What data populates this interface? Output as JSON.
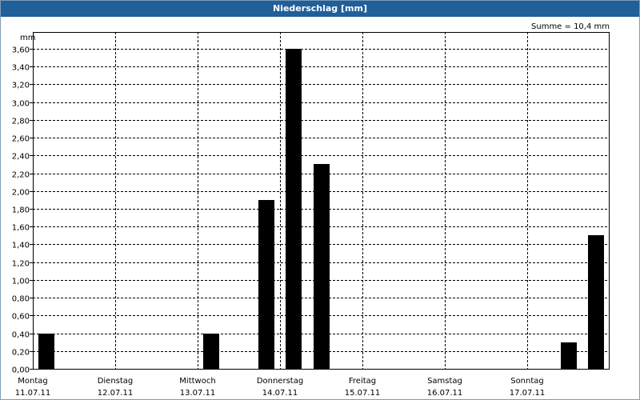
{
  "title": "Niederschlag [mm]",
  "summary": "Summe = 10,4 mm",
  "y_unit": "mm",
  "chart_data": {
    "type": "bar",
    "title": "Niederschlag [mm]",
    "ylabel": "mm",
    "xlabel": "",
    "ylim": [
      0,
      3.8
    ],
    "grid": true,
    "y_ticks": [
      "0,00",
      "0,20",
      "0,40",
      "0,60",
      "0,80",
      "1,00",
      "1,20",
      "1,40",
      "1,60",
      "1,80",
      "2,00",
      "2,20",
      "2,40",
      "2,60",
      "2,80",
      "3,00",
      "3,20",
      "3,40",
      "3,60"
    ],
    "days": [
      {
        "name": "Montag",
        "date": "11.07.11"
      },
      {
        "name": "Dienstag",
        "date": "12.07.11"
      },
      {
        "name": "Mittwoch",
        "date": "13.07.11"
      },
      {
        "name": "Donnerstag",
        "date": "14.07.11"
      },
      {
        "name": "Freitag",
        "date": "15.07.11"
      },
      {
        "name": "Samstag",
        "date": "16.07.11"
      },
      {
        "name": "Sonntag",
        "date": "17.07.11"
      }
    ],
    "bars_per_day": 3,
    "values": [
      0.4,
      0,
      0,
      0,
      0,
      0,
      0.4,
      0,
      1.9,
      3.6,
      2.3,
      0,
      0,
      0,
      0,
      0,
      0,
      0,
      0,
      0.3,
      1.5
    ],
    "bar_color": "#000000",
    "grid_color": "#000000"
  }
}
